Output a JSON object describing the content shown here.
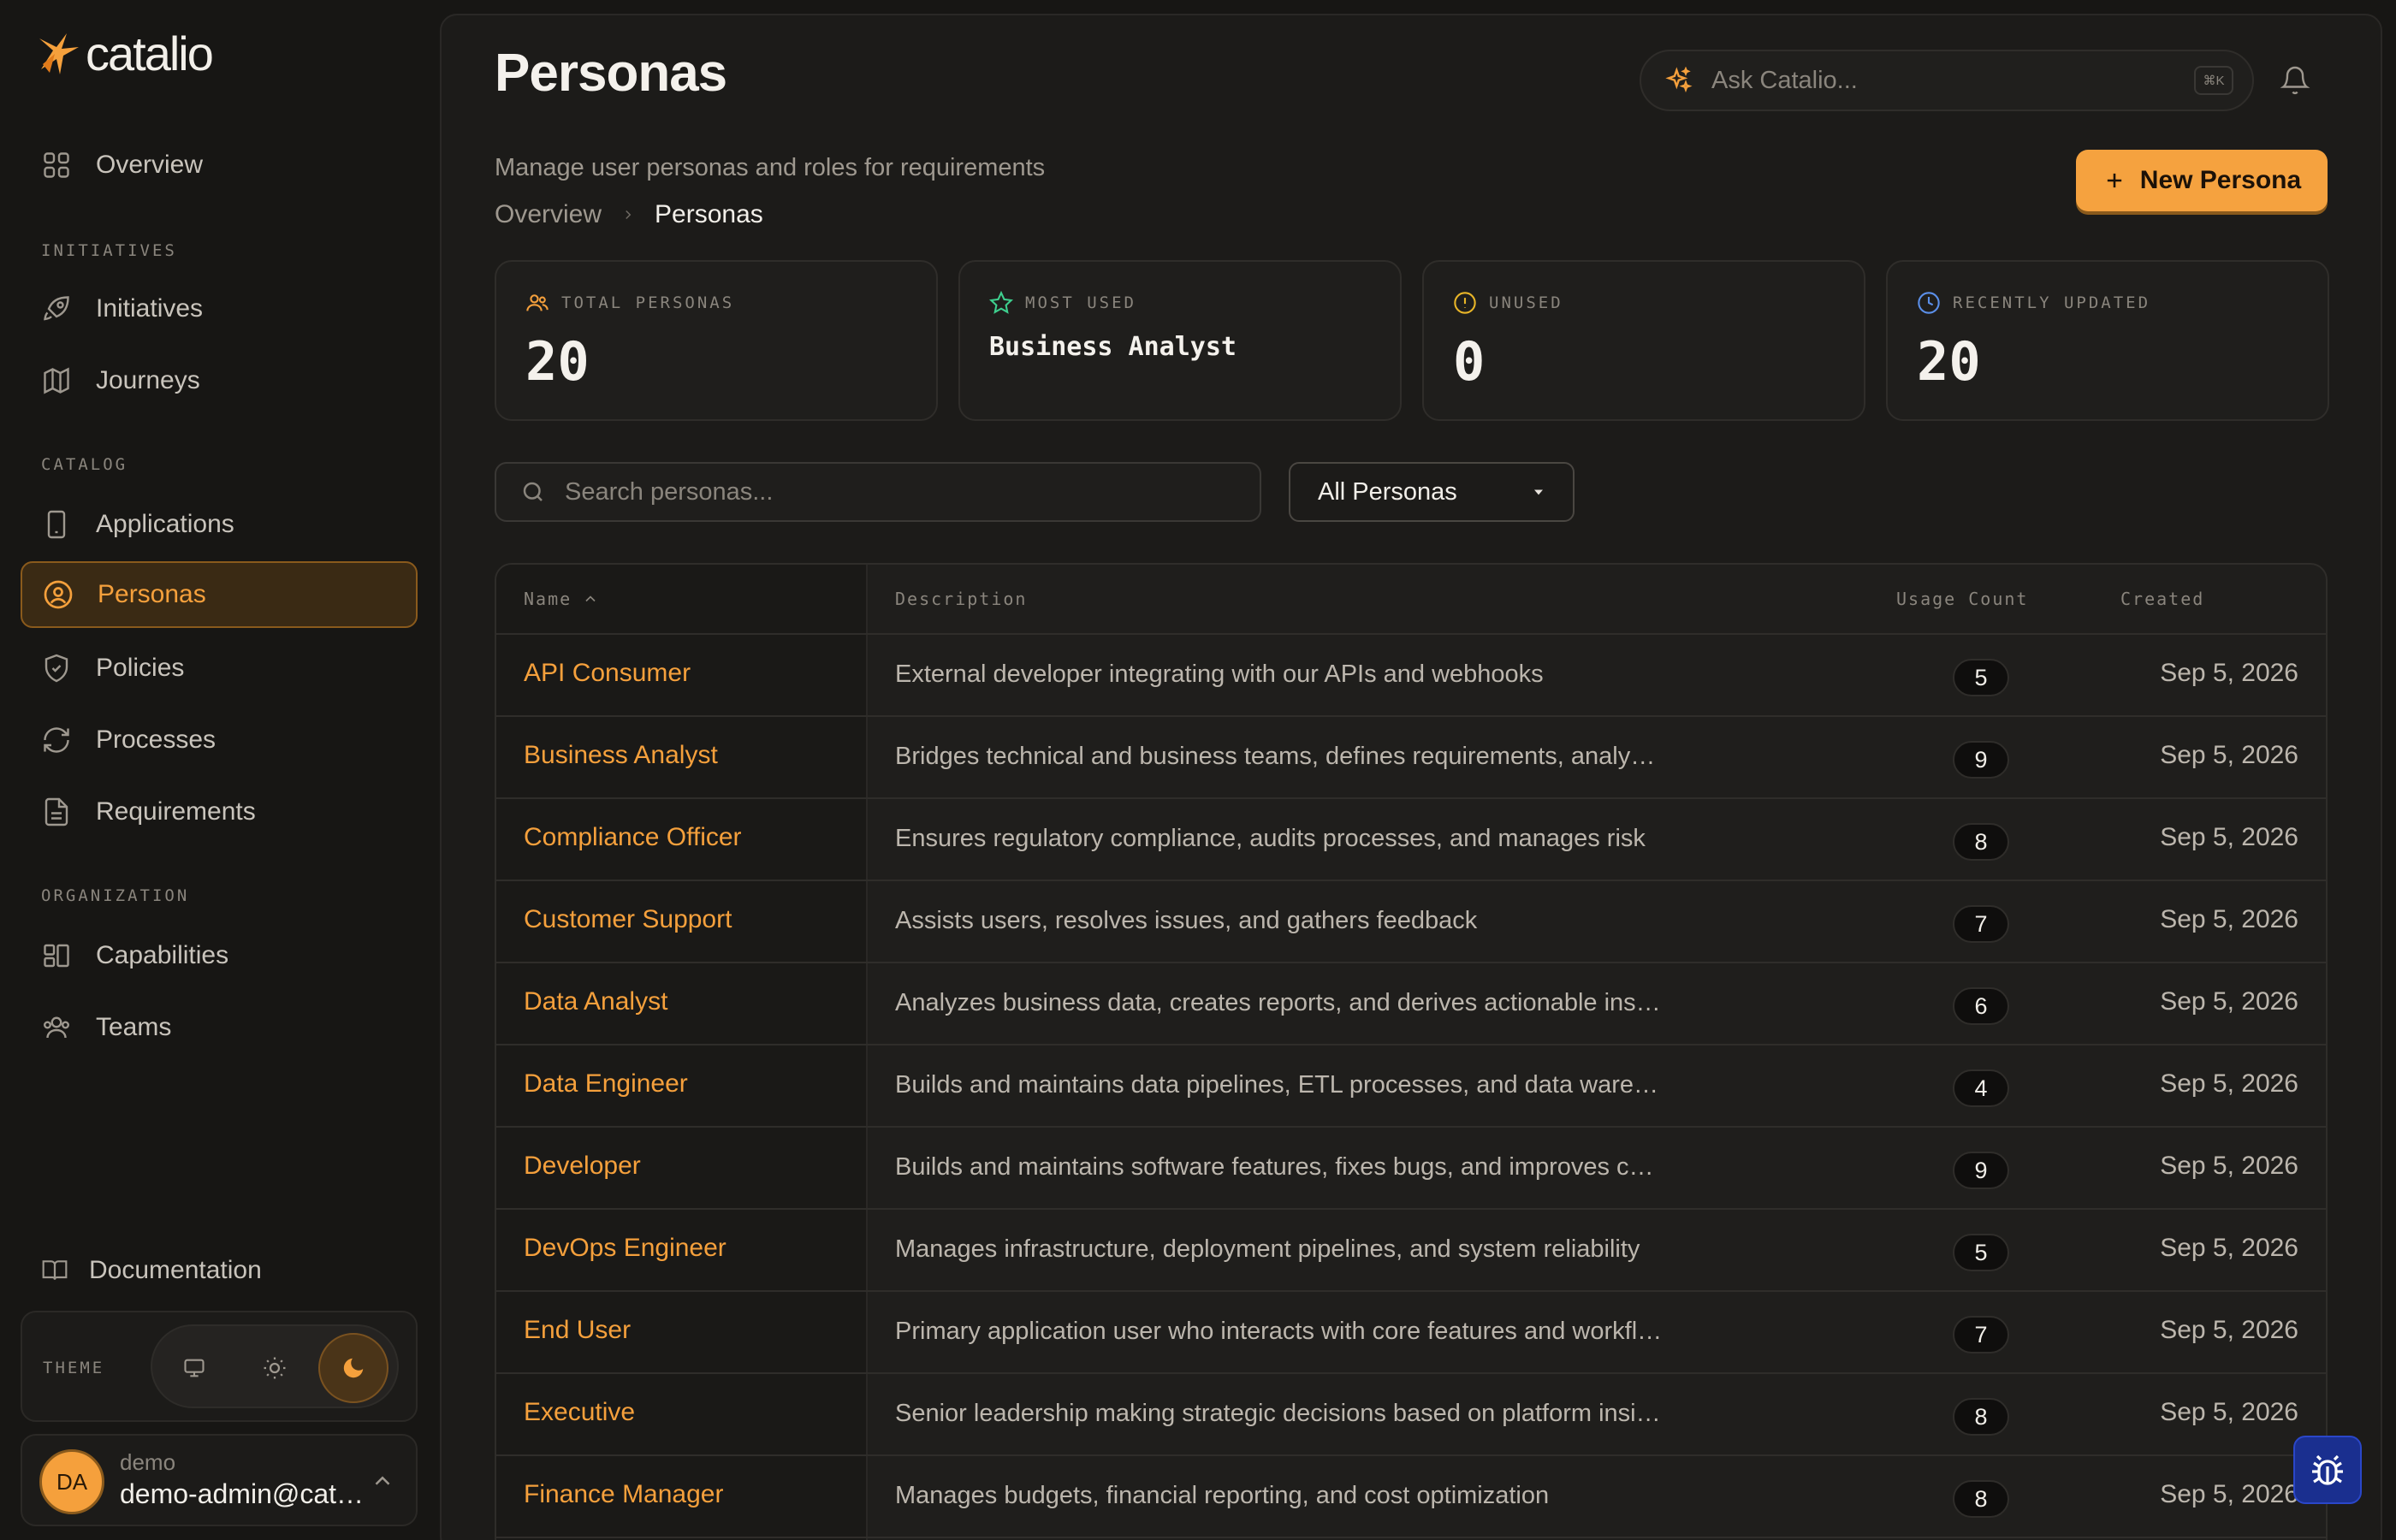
{
  "brand": {
    "name": "catalio"
  },
  "sidebar": {
    "items": [
      {
        "label": "Overview",
        "icon": "grid-icon"
      },
      {
        "label": "Initiatives",
        "icon": "rocket-icon"
      },
      {
        "label": "Journeys",
        "icon": "map-icon"
      },
      {
        "label": "Applications",
        "icon": "phone-icon"
      },
      {
        "label": "Personas",
        "icon": "user-circle-icon",
        "active": true
      },
      {
        "label": "Policies",
        "icon": "shield-icon"
      },
      {
        "label": "Processes",
        "icon": "refresh-icon"
      },
      {
        "label": "Requirements",
        "icon": "document-icon"
      },
      {
        "label": "Capabilities",
        "icon": "blocks-icon"
      },
      {
        "label": "Teams",
        "icon": "users-icon"
      }
    ],
    "sections": {
      "initiatives": "INITIATIVES",
      "catalog": "CATALOG",
      "organization": "ORGANIZATION"
    },
    "documentation": "Documentation",
    "theme": {
      "label": "THEME",
      "options": [
        "system",
        "light",
        "dark"
      ],
      "selected": "dark"
    },
    "user": {
      "initials": "DA",
      "name": "demo",
      "email": "demo-admin@catalio.com"
    }
  },
  "header": {
    "title": "Personas",
    "subtitle": "Manage user personas and roles for requirements",
    "breadcrumb": [
      "Overview",
      "Personas"
    ],
    "ask_placeholder": "Ask Catalio...",
    "ask_shortcut": "⌘K",
    "new_button": "New Persona"
  },
  "stats": [
    {
      "label": "TOTAL PERSONAS",
      "value": "20",
      "icon": "users-icon",
      "color": "#f5a03c"
    },
    {
      "label": "MOST USED",
      "value": "Business Analyst",
      "icon": "star-icon",
      "color": "#3ecf8e"
    },
    {
      "label": "UNUSED",
      "value": "0",
      "icon": "alert-circle-icon",
      "color": "#e8b528"
    },
    {
      "label": "RECENTLY UPDATED",
      "value": "20",
      "icon": "clock-icon",
      "color": "#5b8fe8"
    }
  ],
  "filters": {
    "search_placeholder": "Search personas...",
    "select_value": "All Personas"
  },
  "table": {
    "columns": [
      "Name",
      "Description",
      "Usage Count",
      "Created"
    ],
    "rows": [
      {
        "name": "API Consumer",
        "description": "External developer integrating with our APIs and webhooks",
        "count": "5",
        "created": "Sep 5, 2026"
      },
      {
        "name": "Business Analyst",
        "description": "Bridges technical and business teams, defines requirements, analyzes processes",
        "count": "9",
        "created": "Sep 5, 2026"
      },
      {
        "name": "Compliance Officer",
        "description": "Ensures regulatory compliance, audits processes, and manages risk",
        "count": "8",
        "created": "Sep 5, 2026"
      },
      {
        "name": "Customer Support",
        "description": "Assists users, resolves issues, and gathers feedback",
        "count": "7",
        "created": "Sep 5, 2026"
      },
      {
        "name": "Data Analyst",
        "description": "Analyzes business data, creates reports, and derives actionable insights",
        "count": "6",
        "created": "Sep 5, 2026"
      },
      {
        "name": "Data Engineer",
        "description": "Builds and maintains data pipelines, ETL processes, and data warehouses",
        "count": "4",
        "created": "Sep 5, 2026"
      },
      {
        "name": "Developer",
        "description": "Builds and maintains software features, fixes bugs, and improves code quality",
        "count": "9",
        "created": "Sep 5, 2026"
      },
      {
        "name": "DevOps Engineer",
        "description": "Manages infrastructure, deployment pipelines, and system reliability",
        "count": "5",
        "created": "Sep 5, 2026"
      },
      {
        "name": "End User",
        "description": "Primary application user who interacts with core features and workflows",
        "count": "7",
        "created": "Sep 5, 2026"
      },
      {
        "name": "Executive",
        "description": "Senior leadership making strategic decisions based on platform insights",
        "count": "8",
        "created": "Sep 5, 2026"
      },
      {
        "name": "Finance Manager",
        "description": "Manages budgets, financial reporting, and cost optimization",
        "count": "8",
        "created": "Sep 5, 2026"
      }
    ]
  },
  "colors": {
    "accent": "#f5a03c",
    "background": "#171614",
    "panel": "#1c1b19"
  }
}
